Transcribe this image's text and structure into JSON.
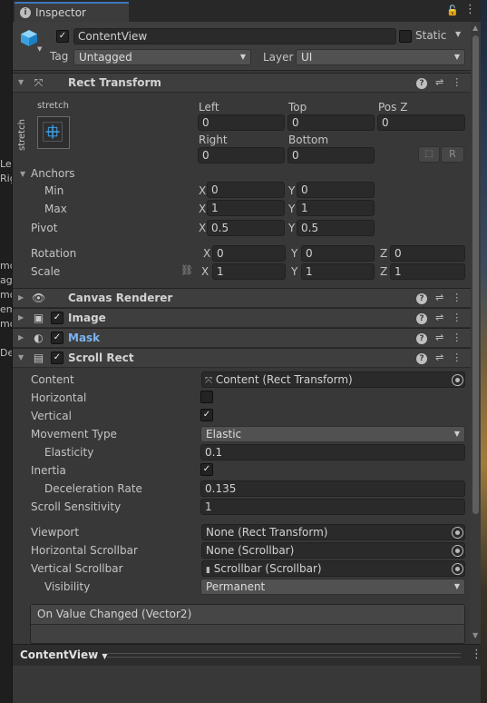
{
  "left_edge_fragments": [
    "Lef",
    "Rig",
    "mo",
    "age",
    "mo",
    "em",
    "mo",
    "Der"
  ],
  "tab": {
    "title": "Inspector",
    "lock_icon": "lock-icon",
    "menu_icon": "kebab-icon"
  },
  "object": {
    "active": true,
    "name": "ContentView",
    "static_label": "Static",
    "static": false,
    "tag_label": "Tag",
    "tag_value": "Untagged",
    "layer_label": "Layer",
    "layer_value": "UI"
  },
  "rect_transform": {
    "title": "Rect Transform",
    "anchor_preset_h": "stretch",
    "anchor_preset_v": "stretch",
    "fields": {
      "left_label": "Left",
      "left": "0",
      "top_label": "Top",
      "top": "0",
      "posz_label": "Pos Z",
      "posz": "0",
      "right_label": "Right",
      "right": "0",
      "bottom_label": "Bottom",
      "bottom": "0"
    },
    "r_button": "R",
    "anchors_label": "Anchors",
    "min_label": "Min",
    "min_x": "0",
    "min_y": "0",
    "max_label": "Max",
    "max_x": "1",
    "max_y": "1",
    "pivot_label": "Pivot",
    "pivot_x": "0.5",
    "pivot_y": "0.5",
    "rotation_label": "Rotation",
    "rot_x": "0",
    "rot_y": "0",
    "rot_z": "0",
    "scale_label": "Scale",
    "scale_x": "1",
    "scale_y": "1",
    "scale_z": "1",
    "axis": {
      "x": "X",
      "y": "Y",
      "z": "Z"
    }
  },
  "components": {
    "canvas_renderer": "Canvas Renderer",
    "image": "Image",
    "mask": "Mask",
    "scroll_rect": "Scroll Rect"
  },
  "scroll_rect": {
    "content_label": "Content",
    "content_value": "Content (Rect Transform)",
    "horizontal_label": "Horizontal",
    "horizontal": false,
    "vertical_label": "Vertical",
    "vertical": true,
    "movement_label": "Movement Type",
    "movement_value": "Elastic",
    "elasticity_label": "Elasticity",
    "elasticity_value": "0.1",
    "inertia_label": "Inertia",
    "inertia": true,
    "deceleration_label": "Deceleration Rate",
    "deceleration_value": "0.135",
    "sensitivity_label": "Scroll Sensitivity",
    "sensitivity_value": "1",
    "viewport_label": "Viewport",
    "viewport_value": "None (Rect Transform)",
    "hscroll_label": "Horizontal Scrollbar",
    "hscroll_value": "None (Scrollbar)",
    "vscroll_label": "Vertical Scrollbar",
    "vscroll_value": "Scrollbar (Scrollbar)",
    "visibility_label": "Visibility",
    "visibility_value": "Permanent",
    "event_label": "On Value Changed (Vector2)"
  },
  "bottom": {
    "selection": "ContentView"
  },
  "colors": {
    "accent_tab": "#3a79bb",
    "mask_title": "#7bb3f0",
    "panel_bg": "#383838"
  }
}
